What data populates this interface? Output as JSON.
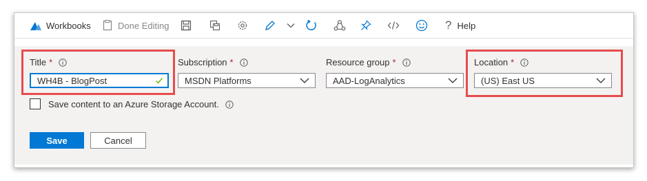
{
  "toolbar": {
    "workbooks_label": "Workbooks",
    "done_editing_label": "Done Editing",
    "help_label": "Help"
  },
  "form": {
    "title": {
      "label": "Title",
      "required_mark": "*",
      "value": "WH4B - BlogPost"
    },
    "subscription": {
      "label": "Subscription",
      "required_mark": "*",
      "value": "MSDN Platforms"
    },
    "resource_group": {
      "label": "Resource group",
      "required_mark": "*",
      "value": "AAD-LogAnalytics"
    },
    "location": {
      "label": "Location",
      "required_mark": "*",
      "value": "(US) East US"
    },
    "storage_checkbox": {
      "label": "Save content to an Azure Storage Account.",
      "checked": false
    }
  },
  "buttons": {
    "save_label": "Save",
    "cancel_label": "Cancel"
  },
  "colors": {
    "accent": "#0078d4",
    "highlight_box": "#e74c4c",
    "required": "#a4262c",
    "valid_check": "#6bb700"
  },
  "icons": [
    "workbooks-icon",
    "done-editing-icon",
    "save-icon",
    "save-as-icon",
    "settings-icon",
    "edit-icon",
    "chevron-down-icon",
    "refresh-icon",
    "share-icon",
    "pin-icon",
    "code-icon",
    "feedback-smiley-icon",
    "help-icon",
    "info-icon",
    "checkmark-icon"
  ]
}
